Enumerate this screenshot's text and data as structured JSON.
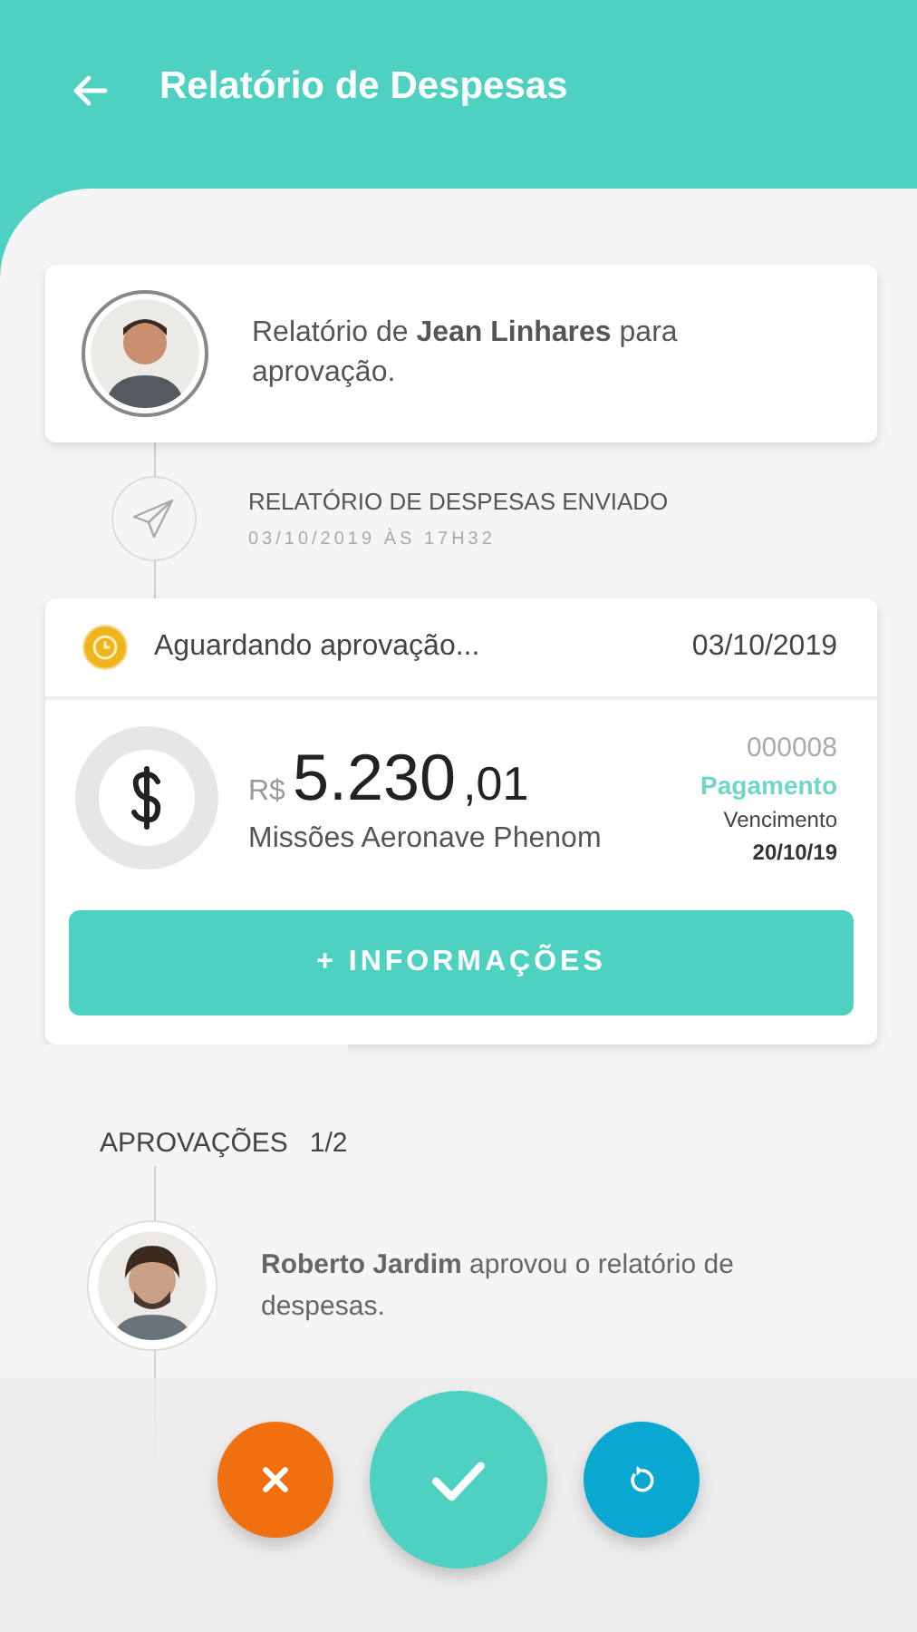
{
  "header": {
    "title": "Relatório de Despesas"
  },
  "submitter": {
    "message": "Relatório de **Jean Linhares** para aprovação."
  },
  "sent_event": {
    "title": "RELATÓRIO DE DESPESAS ENVIADO",
    "timestamp": "03/10/2019 ÀS 17H32"
  },
  "report": {
    "status": "Aguardando aprovação...",
    "date": "03/10/2019",
    "currency": "R$",
    "amount_integer": "5.230",
    "amount_cents": ",01",
    "description": "Missões Aeronave Phenom",
    "number": "000008",
    "type": "Pagamento",
    "due_label": "Vencimento",
    "due_date": "20/10/19",
    "button": "+ INFORMAÇÕES"
  },
  "approvals": {
    "title": "APROVAÇÕES",
    "count": "1/2",
    "items": [
      {
        "message": "**Roberto Jardim** aprovou o relatório de despesas."
      }
    ]
  },
  "actions": [
    {
      "kind": "reject"
    },
    {
      "kind": "approve"
    },
    {
      "kind": "reset"
    }
  ]
}
